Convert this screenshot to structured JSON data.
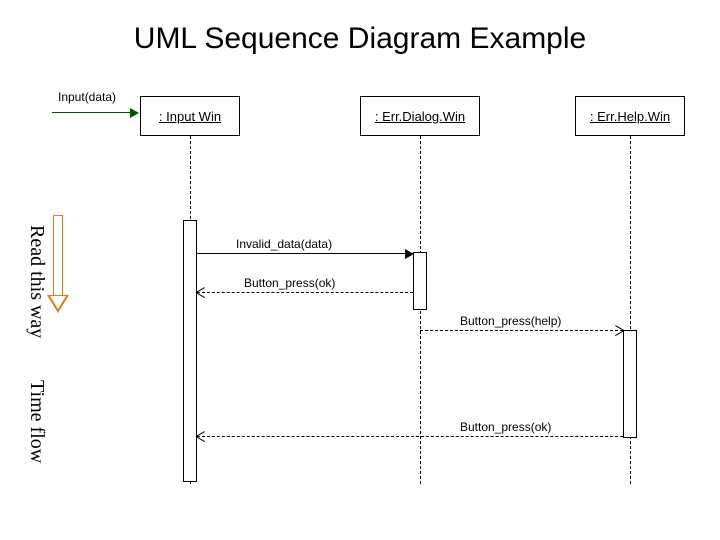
{
  "title": "UML Sequence Diagram Example",
  "input_label": "Input(data)",
  "actors": {
    "a1": ": Input Win",
    "a2": ": Err.Dialog.Win",
    "a3": ": Err.Help.Win"
  },
  "messages": {
    "m1": "Invalid_data(data)",
    "m2": "Button_press(ok)",
    "m3": "Button_press(help)",
    "m4": "Button_press(ok)"
  },
  "side": {
    "read": "Read this way",
    "time": "Time flow"
  }
}
